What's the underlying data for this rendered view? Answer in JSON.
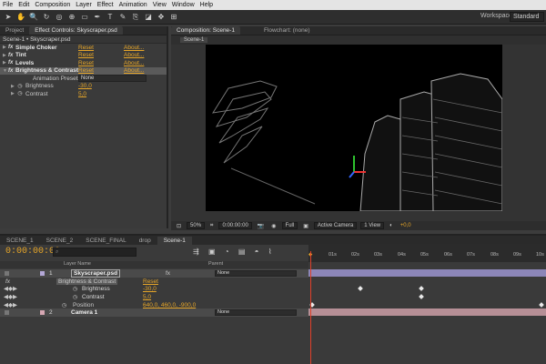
{
  "menu": [
    "File",
    "Edit",
    "Composition",
    "Layer",
    "Effect",
    "Animation",
    "View",
    "Window",
    "Help"
  ],
  "workspace": {
    "label": "Workspace:",
    "value": "Standard"
  },
  "left_tabs": {
    "project": "Project",
    "effect_controls": "Effect Controls: Skyscraper.psd"
  },
  "effects_header": "Scene-1 • Skyscraper.psd",
  "effects": [
    {
      "name": "Simple Choker",
      "reset": "Reset",
      "about": "About..."
    },
    {
      "name": "Tint",
      "reset": "Reset",
      "about": "About..."
    },
    {
      "name": "Levels",
      "reset": "Reset",
      "about": "About..."
    },
    {
      "name": "Brightness & Contrast",
      "reset": "Reset",
      "about": "About..."
    }
  ],
  "presets": {
    "label": "Animation Presets:",
    "value": "None"
  },
  "brightness": {
    "label": "Brightness",
    "value": "-30,0"
  },
  "contrast": {
    "label": "Contrast",
    "value": "5,0"
  },
  "comp_tabs": {
    "composition": "Composition: Scene-1",
    "flowchart": "Flowchart: (none)",
    "scene": "Scene-1"
  },
  "comp_bar": {
    "zoom": "50%",
    "timecode": "0:00:00:00",
    "quality": "Full",
    "camera": "Active Camera",
    "view": "1 View",
    "exposure": "+0,0"
  },
  "timeline_tabs": [
    "SCENE_1",
    "SCENE_2",
    "SCENE_FINAL",
    "drop",
    "Scene-1"
  ],
  "timecode": "0:00:00:00",
  "columns": {
    "layer_name": "Layer Name",
    "parent": "Parent"
  },
  "ruler": [
    "01s",
    "02s",
    "03s",
    "04s",
    "05s",
    "06s",
    "07s",
    "08s",
    "09s",
    "10s"
  ],
  "layers": {
    "l1": {
      "num": "1",
      "name": "Skyscraper.psd",
      "parent": "None"
    },
    "effect": {
      "name": "Brightness & Contrast",
      "reset": "Reset"
    },
    "brightness": {
      "label": "Brightness",
      "value": "-30,0"
    },
    "contrast": {
      "label": "Contrast",
      "value": "5,0"
    },
    "position": {
      "label": "Position",
      "value": "640,0, 460,0, -900,0"
    },
    "l2": {
      "num": "2",
      "name": "Camera 1",
      "parent": "None"
    }
  }
}
